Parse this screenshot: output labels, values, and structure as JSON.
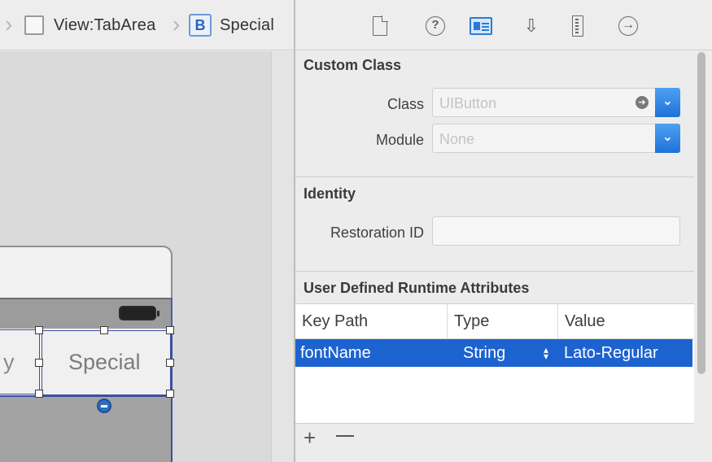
{
  "jumpbar": {
    "view_label": "View:TabArea",
    "button_badge": "B",
    "button_label": "Special"
  },
  "canvas": {
    "tab_partial_label": "y",
    "tab_special_label": "Special"
  },
  "inspector": {
    "toolbar_icons": [
      "file-icon",
      "help-icon",
      "identity-inspector-icon",
      "attributes-icon",
      "size-icon",
      "connections-icon"
    ],
    "custom_class": {
      "title": "Custom Class",
      "class_label": "Class",
      "class_placeholder": "UIButton",
      "module_label": "Module",
      "module_placeholder": "None"
    },
    "identity": {
      "title": "Identity",
      "restoration_label": "Restoration ID",
      "restoration_value": ""
    },
    "runtime_attrs": {
      "title": "User Defined Runtime Attributes",
      "headers": [
        "Key Path",
        "Type",
        "Value"
      ],
      "rows": [
        {
          "key_path": "fontName",
          "type": "String",
          "value": "Lato-Regular"
        }
      ],
      "add_label": "+"
    }
  },
  "colors": {
    "selection": "#1d63d0",
    "popup_accent": "#2c7ad6",
    "frame_outline": "#3d4f9e"
  }
}
